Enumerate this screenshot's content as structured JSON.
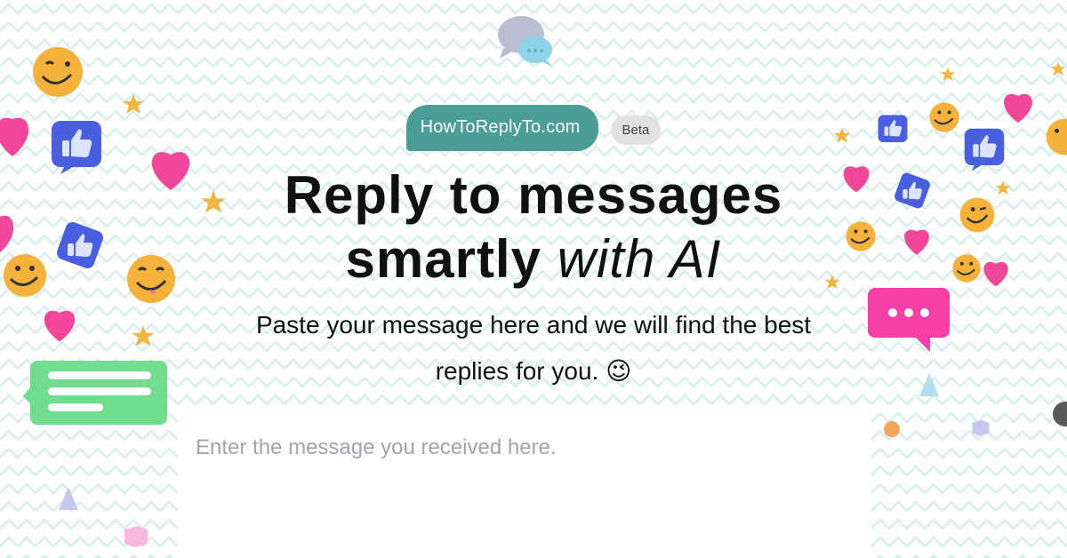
{
  "header": {
    "brand": "HowToReplyTo.com",
    "badge": "Beta"
  },
  "hero": {
    "headline_line1": "Reply to messages",
    "headline_strong": "smartly",
    "headline_em": "with AI",
    "subtitle_line1": "Paste your message here and we will find the best",
    "subtitle_line2": "replies for you. 😉"
  },
  "input": {
    "placeholder": "Enter the message you received here.",
    "value": ""
  },
  "colors": {
    "brand_pill": "#4a9e96",
    "badge_bg": "#e2e2e2",
    "heart": "#f0479a",
    "like_badge": "#4a5fe0",
    "smiley": "#f5b23a",
    "chat_green": "#6fdc8e",
    "chat_pink": "#f53fa6"
  },
  "icons": [
    "chat-bubbles-icon",
    "smiley-icon",
    "thumbs-up-icon",
    "heart-icon",
    "star-icon",
    "text-bubble-icon",
    "typing-bubble-icon"
  ]
}
